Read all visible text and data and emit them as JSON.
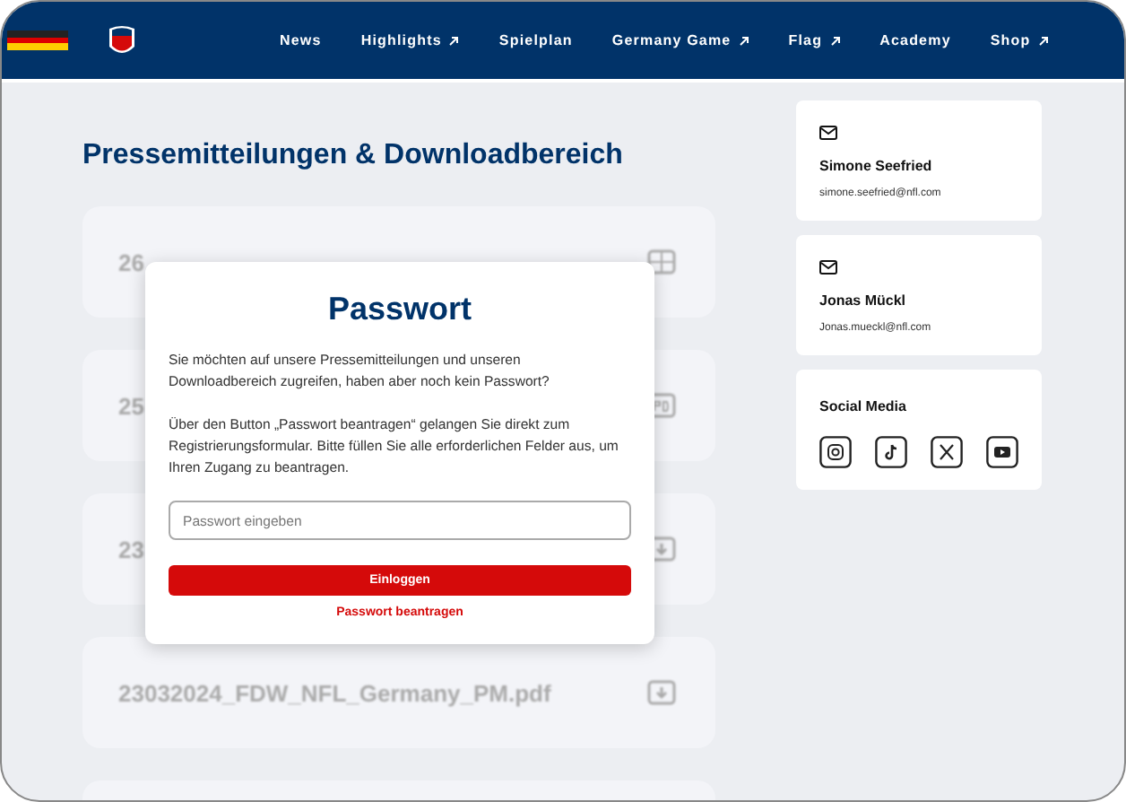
{
  "nav": {
    "items": [
      {
        "label": "News",
        "external": false
      },
      {
        "label": "Highlights",
        "external": true
      },
      {
        "label": "Spielplan",
        "external": false
      },
      {
        "label": "Germany Game",
        "external": true
      },
      {
        "label": "Flag",
        "external": true
      },
      {
        "label": "Academy",
        "external": false
      },
      {
        "label": "Shop",
        "external": true
      }
    ]
  },
  "page": {
    "title": "Pressemitteilungen & Downloadbereich"
  },
  "files": [
    {
      "name": "26",
      "kind": "sheet"
    },
    {
      "name": "25",
      "kind": "pdf"
    },
    {
      "name": "23",
      "kind": "download"
    },
    {
      "name": "23032024_FDW_NFL_Germany_PM.pdf",
      "kind": "download"
    },
    {
      "kind": "empty"
    }
  ],
  "contacts": [
    {
      "name": "Simone Seefried",
      "email": "simone.seefried@nfl.com"
    },
    {
      "name": "Jonas Mückl",
      "email": "Jonas.mueckl@nfl.com"
    }
  ],
  "social": {
    "title": "Social Media",
    "links": [
      {
        "kind": "instagram"
      },
      {
        "kind": "tiktok"
      },
      {
        "kind": "x"
      },
      {
        "kind": "youtube"
      }
    ]
  },
  "modal": {
    "title": "Passwort",
    "paragraphs": [
      "Sie möchten auf unsere Pressemitteilungen und unseren Downloadbereich zugreifen, haben aber noch kein Passwort?",
      "Über den Button „Passwort beantragen“ gelangen Sie direkt zum Registrierungsformular. Bitte füllen Sie alle erforderlichen Felder aus, um Ihren Zugang zu beantragen."
    ],
    "placeholder": "Passwort eingeben",
    "button": "Einloggen",
    "link": "Passwort beantragen"
  }
}
